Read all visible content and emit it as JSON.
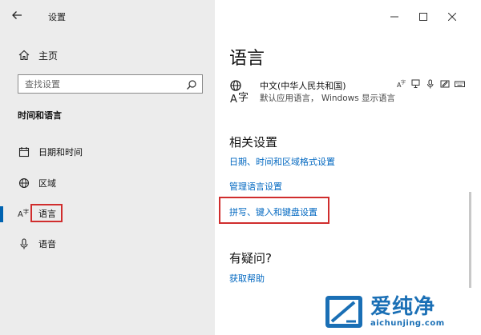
{
  "window": {
    "title": "设置"
  },
  "sidebar": {
    "home_label": "主页",
    "search_placeholder": "查找设置",
    "section_title": "时间和语言",
    "items": [
      {
        "label": "日期和时间",
        "icon": "calendar-icon"
      },
      {
        "label": "区域",
        "icon": "globe-icon"
      },
      {
        "label": "语言",
        "icon": "language-icon",
        "active": true
      },
      {
        "label": "语音",
        "icon": "microphone-icon"
      }
    ]
  },
  "main": {
    "title": "语言",
    "language": {
      "name": "中文(中华人民共和国)",
      "description": "默认应用语言， Windows 显示语言",
      "feature_icons": [
        "language-pack-icon",
        "speech-icon",
        "handwriting-icon",
        "keyboard-icon"
      ]
    },
    "related": {
      "title": "相关设置",
      "links": [
        "日期、时间和区域格式设置",
        "管理语言设置",
        "拼写、键入和键盘设置"
      ]
    },
    "help": {
      "title": "有疑问?",
      "link": "获取帮助"
    }
  },
  "watermark": {
    "brand": "爱纯净",
    "url": "aichunjing.com"
  },
  "colors": {
    "accent": "#0063b1",
    "link": "#0067c0",
    "highlight_box": "#d02d2d",
    "sidebar_bg": "#ececec",
    "watermark": "#1a6fb5"
  }
}
